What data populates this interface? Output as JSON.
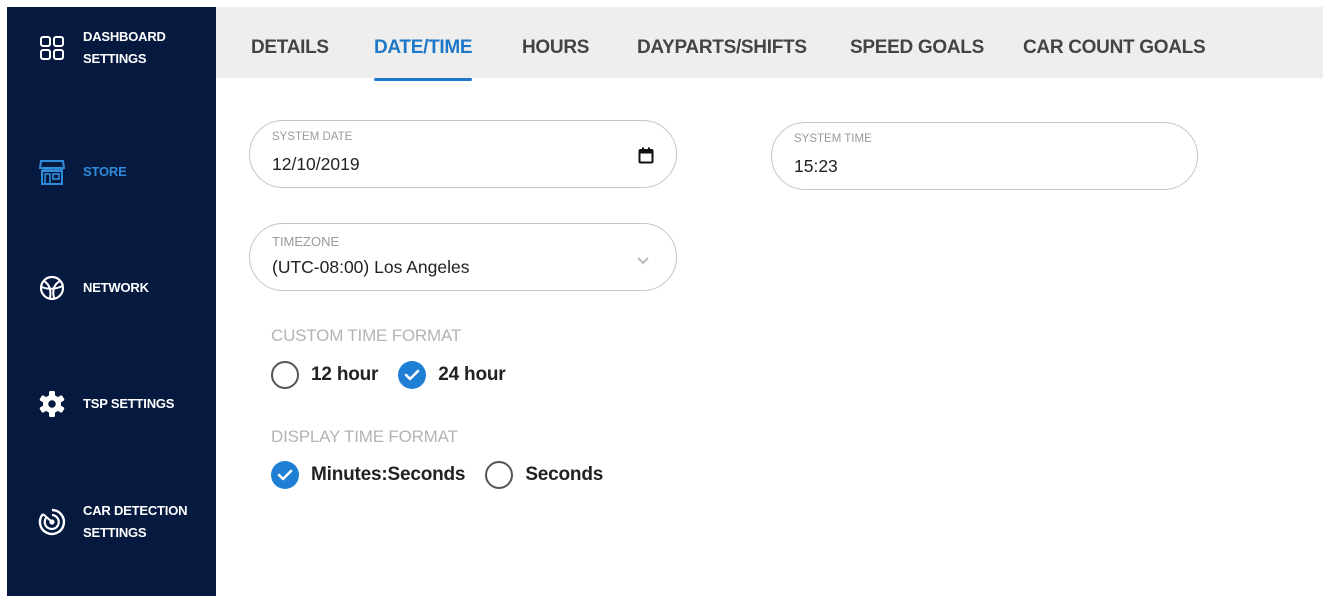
{
  "sidebar": {
    "items": [
      {
        "label": "DASHBOARD SETTINGS",
        "icon": "dashboard-grid-icon",
        "active": false
      },
      {
        "label": "STORE",
        "icon": "storefront-icon",
        "active": true
      },
      {
        "label": "NETWORK",
        "icon": "globe-network-icon",
        "active": false
      },
      {
        "label": "TSP SETTINGS",
        "icon": "gear-icon",
        "active": false
      },
      {
        "label": "CAR DETECTION SETTINGS",
        "icon": "radar-detection-icon",
        "active": false
      }
    ]
  },
  "tabs": [
    {
      "label": "DETAILS",
      "active": false
    },
    {
      "label": "DATE/TIME",
      "active": true
    },
    {
      "label": "HOURS",
      "active": false
    },
    {
      "label": "DAYPARTS/SHIFTS",
      "active": false
    },
    {
      "label": "SPEED GOALS",
      "active": false
    },
    {
      "label": "CAR COUNT GOALS",
      "active": false
    }
  ],
  "form": {
    "system_date": {
      "label": "SYSTEM DATE",
      "value": "12/10/2019",
      "icon": "calendar-icon"
    },
    "system_time": {
      "label": "SYSTEM TIME",
      "value": "15:23"
    },
    "timezone": {
      "label": "TIMEZONE",
      "value": "(UTC-08:00) Los Angeles",
      "icon": "chevron-down-icon"
    },
    "custom_time_format": {
      "label": "CUSTOM TIME FORMAT",
      "options": [
        {
          "label": "12 hour",
          "checked": false
        },
        {
          "label": "24 hour",
          "checked": true
        }
      ]
    },
    "display_time_format": {
      "label": "DISPLAY TIME FORMAT",
      "options": [
        {
          "label": "Minutes:Seconds",
          "checked": true
        },
        {
          "label": "Seconds",
          "checked": false
        }
      ]
    }
  },
  "colors": {
    "sidebar_bg": "#061a40",
    "accent": "#1e78c8",
    "tabbar_bg": "#eeeeee"
  }
}
